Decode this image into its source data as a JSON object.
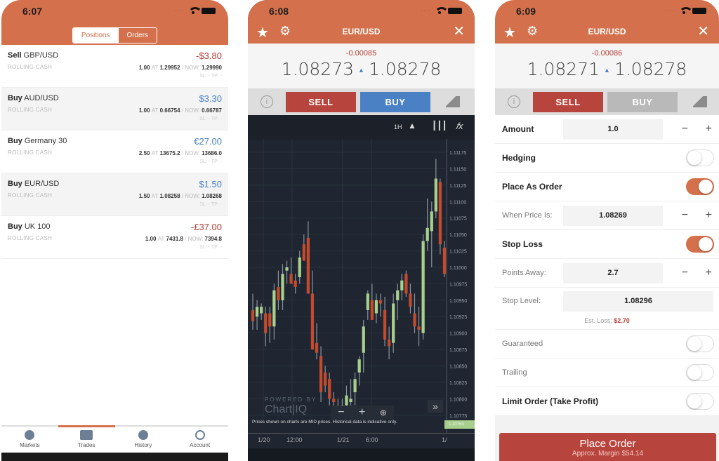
{
  "screens": [
    {
      "time": "6:07",
      "segments": [
        {
          "label": "Positions",
          "active": true
        },
        {
          "label": "Orders",
          "active": false
        }
      ],
      "positions": [
        {
          "side": "Sell",
          "instrument": "GBP/USD",
          "type": "ROLLING CASH",
          "pnl": "-$3.80",
          "pnl_sign": "neg",
          "size": "1.00",
          "at_label": "AT",
          "open": "1.29952",
          "now_label": "/ NOW:",
          "now": "1.29990",
          "sltp": "SL: -   TP: -"
        },
        {
          "side": "Buy",
          "instrument": "AUD/USD",
          "type": "ROLLING CASH",
          "pnl": "$3.30",
          "pnl_sign": "pos",
          "size": "1.00",
          "at_label": "AT",
          "open": "0.66754",
          "now_label": "/ NOW:",
          "now": "0.66787",
          "sltp": "SL: -   TP: -"
        },
        {
          "side": "Buy",
          "instrument": "Germany 30",
          "type": "ROLLING CASH",
          "pnl": "€27.00",
          "pnl_sign": "pos",
          "size": "2.50",
          "at_label": "AT",
          "open": "13675.2",
          "now_label": "/ NOW:",
          "now": "13686.0",
          "sltp": "SL: -   TP: -"
        },
        {
          "side": "Buy",
          "instrument": "EUR/USD",
          "type": "ROLLING CASH",
          "pnl": "$1.50",
          "pnl_sign": "pos",
          "size": "1.50",
          "at_label": "AT",
          "open": "1.08258",
          "now_label": "/ NOW:",
          "now": "1.08268",
          "sltp": "SL: -   TP: -"
        },
        {
          "side": "Buy",
          "instrument": "UK 100",
          "type": "ROLLING CASH",
          "pnl": "-£37.00",
          "pnl_sign": "neg",
          "size": "1.00",
          "at_label": "AT",
          "open": "7431.8",
          "now_label": "/ NOW:",
          "now": "7394.8",
          "sltp": "SL: -   TP: -"
        }
      ],
      "tabs": [
        "Markets",
        "Trades",
        "History",
        "Account"
      ],
      "active_tab": "Trades"
    },
    {
      "time": "6:08",
      "title": "EUR/USD",
      "change": "-0.00085",
      "bid": "1.08273",
      "ask": "1.08278",
      "sell_label": "SELL",
      "buy_label": "BUY",
      "chart_toolbar": {
        "interval": "1H"
      },
      "powered_by": "POWERED BY",
      "brand": "Chart|IQ",
      "disclaimer": "Prices shown on charts are MID prices. Historical data is indicative only.",
      "x_ticks": [
        "1/20",
        "12:00",
        "1/21",
        "6:00",
        "1/"
      ],
      "y_ticks": [
        "1.11175",
        "1.11150",
        "1.11125",
        "1.11100",
        "1.11075",
        "1.11050",
        "1.11025",
        "1.11000",
        "1.10975",
        "1.10950",
        "1.10925",
        "1.10900",
        "1.10875",
        "1.10850",
        "1.10825",
        "1.10800",
        "1.10775"
      ],
      "current_price_tag": "1.10763"
    },
    {
      "time": "6:09",
      "title": "EUR/USD",
      "change": "-0.00086",
      "bid": "1.08271",
      "ask": "1.08278",
      "sell_label": "SELL",
      "buy_label": "BUY",
      "form": {
        "amount_label": "Amount",
        "amount": "1.0",
        "hedging_label": "Hedging",
        "hedging": false,
        "place_as_order_label": "Place As Order",
        "place_as_order": true,
        "when_price_label": "When Price Is:",
        "when_price": "1.08269",
        "stop_loss_label": "Stop Loss",
        "stop_loss": true,
        "points_away_label": "Points Away:",
        "points_away": "2.7",
        "stop_level_label": "Stop Level:",
        "stop_level": "1.08296",
        "est_loss_label": "Est. Loss:",
        "est_loss": "$2.70",
        "guaranteed_label": "Guaranteed",
        "guaranteed": false,
        "trailing_label": "Trailing",
        "trailing": false,
        "limit_label": "Limit Order (Take Profit)",
        "limit": false
      },
      "place_order_label": "Place Order",
      "margin_text": "Approx. Margin $54.14"
    }
  ],
  "chart_data": {
    "type": "candlestick",
    "instrument": "EUR/USD",
    "interval": "1H",
    "ylim": [
      1.10763,
      1.1119
    ],
    "candles": [
      [
        1.10935,
        1.1096,
        1.10905,
        1.10918
      ],
      [
        1.10925,
        1.1095,
        1.10905,
        1.1094
      ],
      [
        1.1093,
        1.10945,
        1.1092,
        1.1094
      ],
      [
        1.1093,
        1.1094,
        1.1088,
        1.109
      ],
      [
        1.1093,
        1.1094,
        1.10885,
        1.1091
      ],
      [
        1.1091,
        1.10975,
        1.1089,
        1.10965
      ],
      [
        1.1097,
        1.10995,
        1.10935,
        1.1095
      ],
      [
        1.1095,
        1.11005,
        1.10935,
        1.1099
      ],
      [
        1.10995,
        1.1101,
        1.10975,
        1.11
      ],
      [
        1.1099,
        1.11015,
        1.10975,
        1.10975
      ],
      [
        1.1098,
        1.1099,
        1.1096,
        1.1097
      ],
      [
        1.10985,
        1.11025,
        1.10975,
        1.11015
      ],
      [
        1.11035,
        1.1105,
        1.11015,
        1.1101
      ],
      [
        1.11045,
        1.1107,
        1.1096,
        1.1096
      ],
      [
        1.1096,
        1.10995,
        1.10875,
        1.10875
      ],
      [
        1.10885,
        1.10915,
        1.1086,
        1.1087
      ],
      [
        1.10865,
        1.1088,
        1.10795,
        1.1081
      ],
      [
        1.1084,
        1.1085,
        1.1081,
        1.1082
      ],
      [
        1.1083,
        1.1084,
        1.1079,
        1.108
      ],
      [
        1.108,
        1.1081,
        1.1078,
        1.10795
      ],
      [
        1.1079,
        1.108,
        1.1077,
        1.1078
      ],
      [
        1.1078,
        1.108,
        1.1077,
        1.1079
      ],
      [
        1.1079,
        1.1082,
        1.1078,
        1.10805
      ],
      [
        1.10795,
        1.1083,
        1.1079,
        1.108
      ],
      [
        1.1081,
        1.1084,
        1.1079,
        1.1083
      ],
      [
        1.1084,
        1.10865,
        1.1082,
        1.1086
      ],
      [
        1.1087,
        1.1092,
        1.1084,
        1.1091
      ],
      [
        1.10935,
        1.10965,
        1.1092,
        1.1096
      ],
      [
        1.1095,
        1.10975,
        1.1093,
        1.1092
      ],
      [
        1.1093,
        1.1096,
        1.10915,
        1.1095
      ],
      [
        1.1095,
        1.1096,
        1.10925,
        1.10945
      ],
      [
        1.10935,
        1.10955,
        1.1088,
        1.1089
      ],
      [
        1.1089,
        1.1091,
        1.1086,
        1.1088
      ],
      [
        1.10885,
        1.1096,
        1.1087,
        1.10945
      ],
      [
        1.1095,
        1.10975,
        1.1092,
        1.10965
      ],
      [
        1.10965,
        1.1099,
        1.1095,
        1.1098
      ],
      [
        1.1099,
        1.10995,
        1.10955,
        1.1096
      ],
      [
        1.1096,
        1.10975,
        1.1093,
        1.1094
      ],
      [
        1.1093,
        1.1096,
        1.109,
        1.1091
      ],
      [
        1.1091,
        1.1094,
        1.1088,
        1.10905
      ],
      [
        1.109,
        1.1105,
        1.1089,
        1.1104
      ],
      [
        1.1104,
        1.11105,
        1.11025,
        1.1106
      ],
      [
        1.11055,
        1.111,
        1.11,
        1.11085
      ],
      [
        1.11085,
        1.11165,
        1.11075,
        1.11135
      ],
      [
        1.1113,
        1.11135,
        1.1102,
        1.11035
      ],
      [
        1.1103,
        1.1104,
        1.10985,
        1.1099
      ]
    ]
  }
}
